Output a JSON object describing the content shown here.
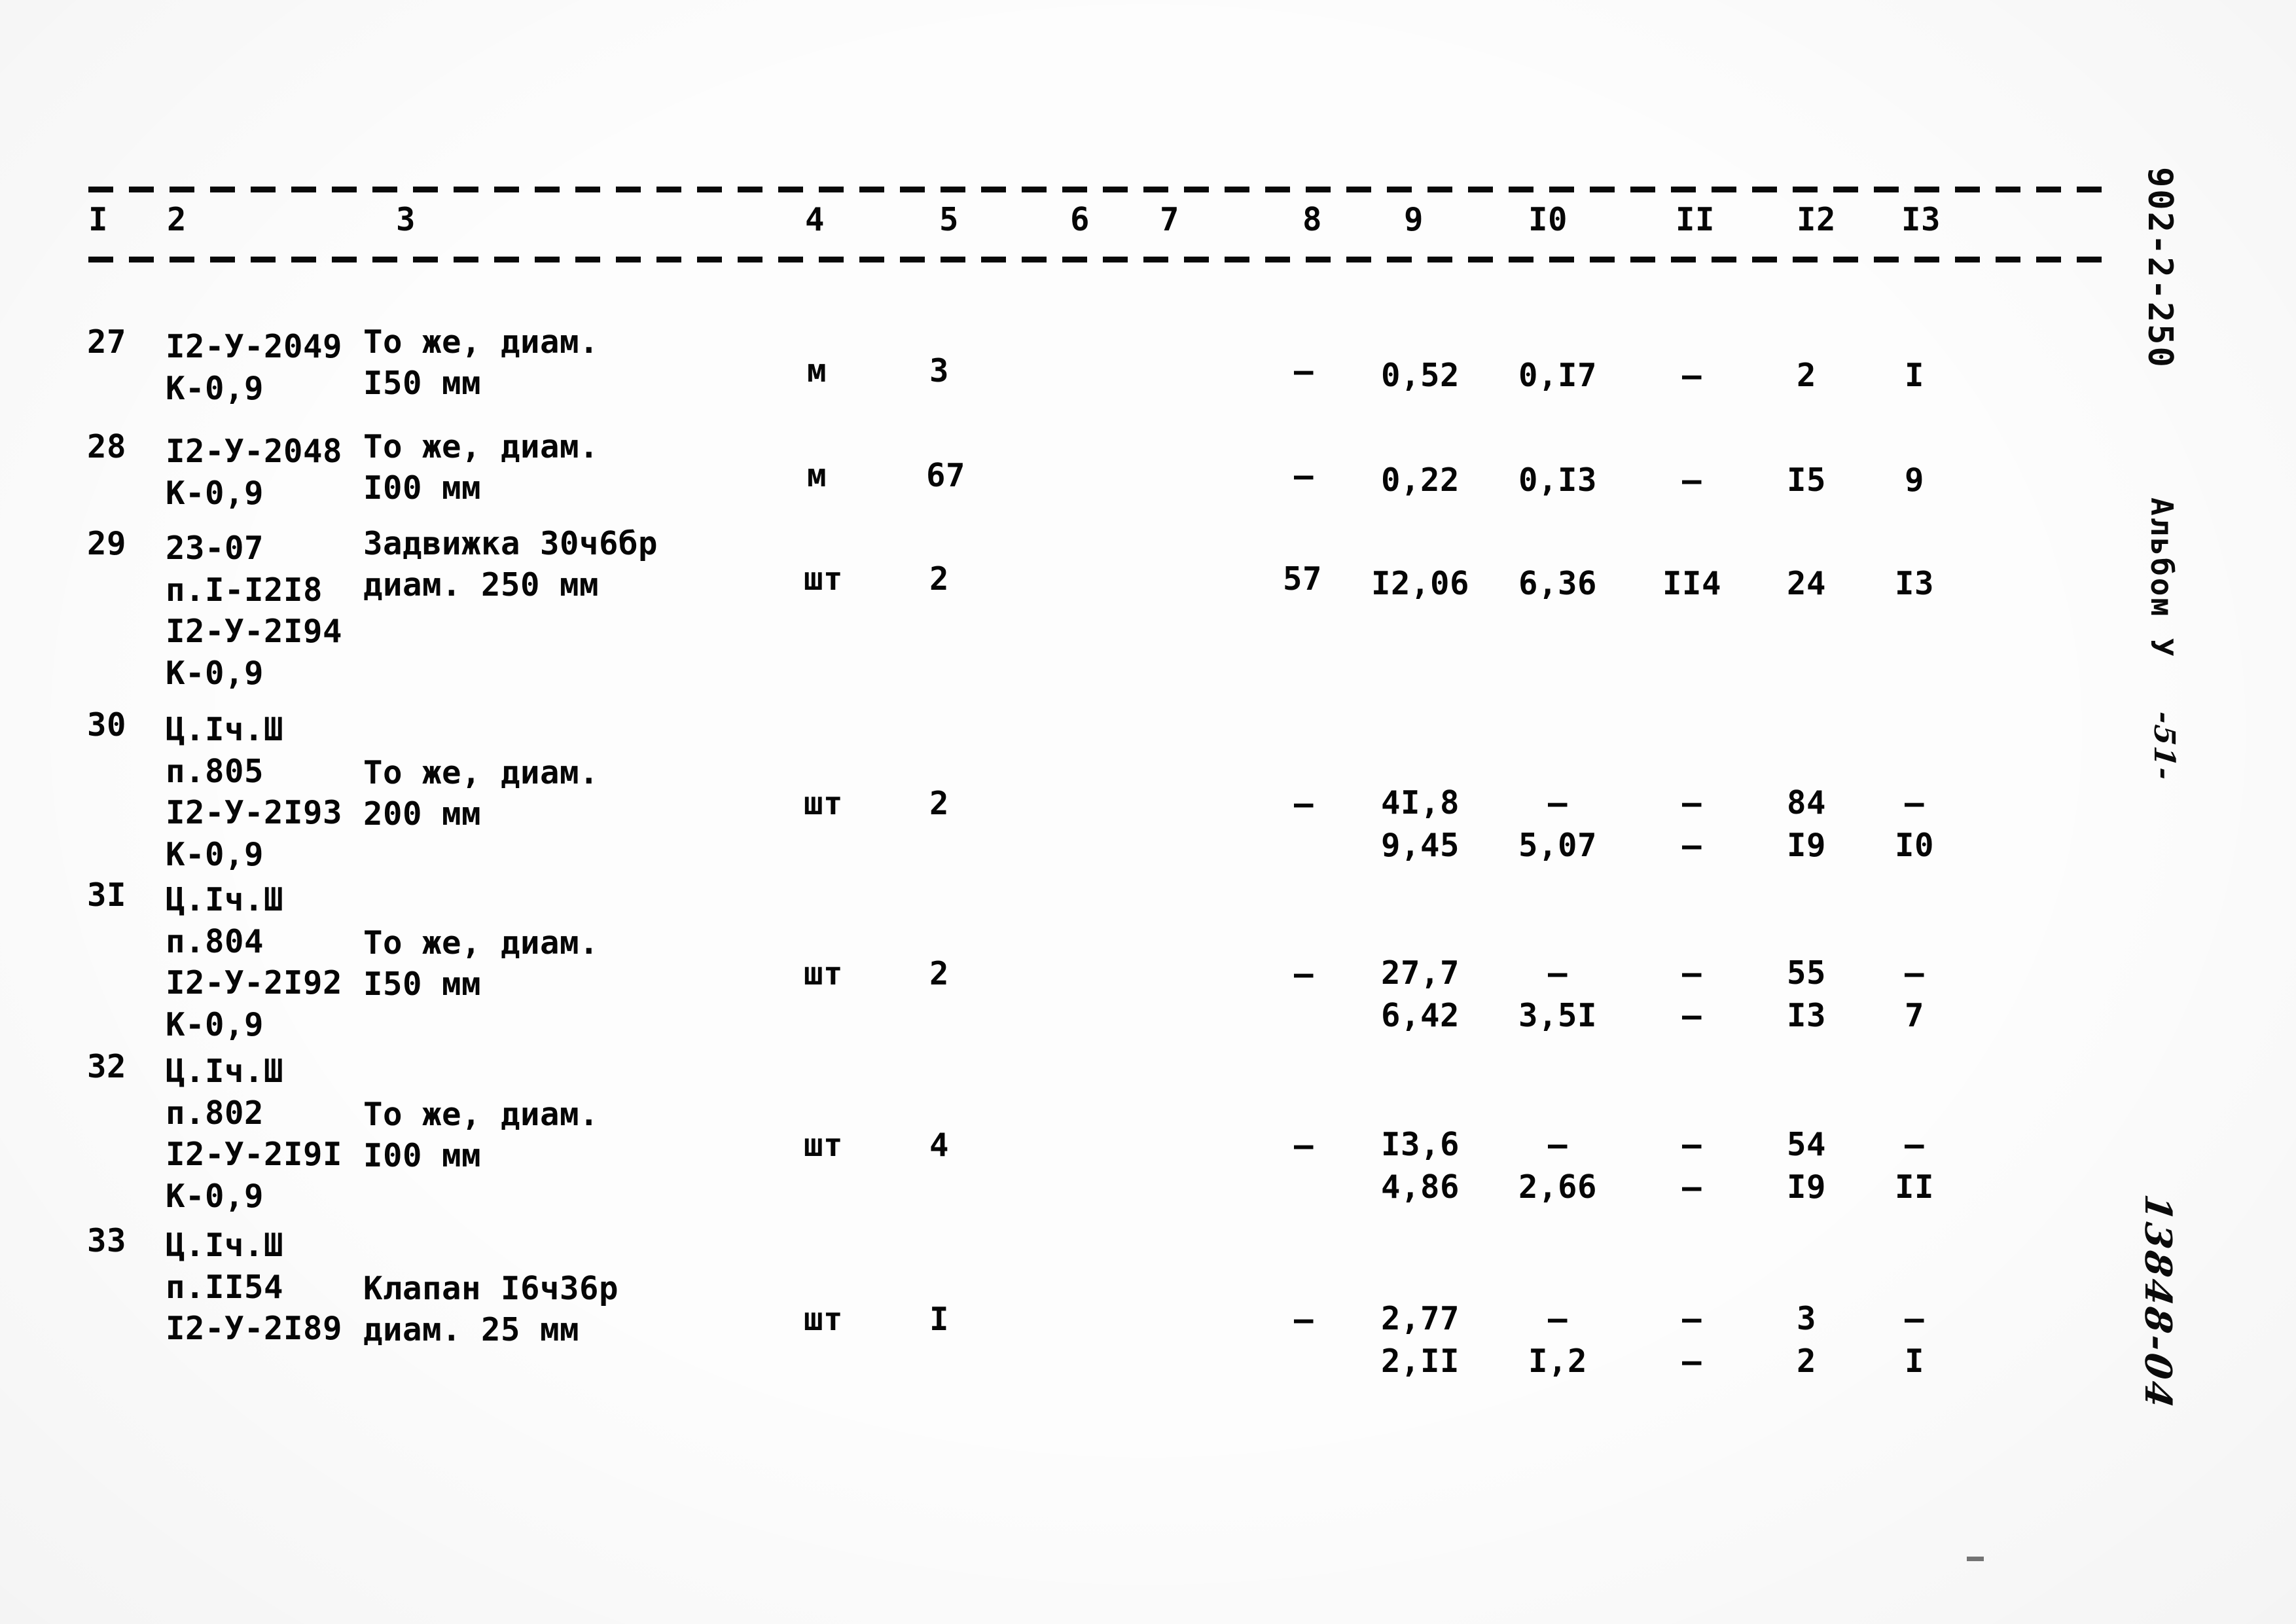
{
  "document": {
    "doc_code": "902-2-250",
    "album_label": "Альбом У",
    "page_number": "-51-",
    "archive_number": "13848-04"
  },
  "table": {
    "column_headers": [
      "I",
      "2",
      "3",
      "4",
      "5",
      "6",
      "7",
      "8",
      "9",
      "I0",
      "II",
      "I2",
      "I3"
    ],
    "rows": [
      {
        "no": "27",
        "code": "I2-У-2049\nК-0,9",
        "description": "То же, диам.\nI50 мм",
        "unit": "м",
        "qty": "3",
        "c6": "",
        "c7": "",
        "c8": "–",
        "c9": "0,52",
        "c10": "0,I7",
        "c11": "–",
        "c12": "2",
        "c13": "I"
      },
      {
        "no": "28",
        "code": "I2-У-2048\nК-0,9",
        "description": "То же, диам.\nI00 мм",
        "unit": "м",
        "qty": "67",
        "c6": "",
        "c7": "",
        "c8": "–",
        "c9": "0,22",
        "c10": "0,I3",
        "c11": "–",
        "c12": "I5",
        "c13": "9"
      },
      {
        "no": "29",
        "code": "23-07\nп.I-I2I8\nI2-У-2I94\nК-0,9",
        "description": "Задвижка 30ч6бр\nдиам. 250 мм",
        "unit": "шт",
        "qty": "2",
        "c6": "",
        "c7": "",
        "c8": "57",
        "c9": "I2,06",
        "c10": "6,36",
        "c11": "II4",
        "c12": "24",
        "c13": "I3"
      },
      {
        "no": "30",
        "code": "Ц.Iч.Ш\nп.805\nI2-У-2I93\nК-0,9",
        "description": "То же, диам.\n  200 мм",
        "unit": "шт",
        "qty": "2",
        "c6": "",
        "c7": "",
        "c8": "–",
        "c9": "4I,8\n9,45",
        "c10": "–\n5,07",
        "c11": "–\n–",
        "c12": "84\nI9",
        "c13": "–\nI0"
      },
      {
        "no": "3I",
        "code": "Ц.Iч.Ш\nп.804\nI2-У-2I92\nК-0,9",
        "description": "То же, диам.\n I50 мм",
        "unit": "шт",
        "qty": "2",
        "c6": "",
        "c7": "",
        "c8": "–",
        "c9": "27,7\n6,42",
        "c10": "–\n3,5I",
        "c11": "–\n–",
        "c12": "55\nI3",
        "c13": "–\n7"
      },
      {
        "no": "32",
        "code": "Ц.Iч.Ш\nп.802\nI2-У-2I9I\nК-0,9",
        "description": "То же, диам.\nI00 мм",
        "unit": "шт",
        "qty": "4",
        "c6": "",
        "c7": "",
        "c8": "–",
        "c9": "I3,6\n4,86",
        "c10": "–\n2,66",
        "c11": "–\n–",
        "c12": "54\nI9",
        "c13": "–\nII"
      },
      {
        "no": "33",
        "code": "Ц.Iч.Ш\nп.II54\nI2-У-2I89",
        "description": "Клапан I6ч36р\nдиам. 25 мм",
        "unit": "шт",
        "qty": "I",
        "c6": "",
        "c7": "",
        "c8": "–",
        "c9": "2,77\n2,II",
        "c10": "–\nI,2",
        "c11": "–\n–",
        "c12": "3\n2",
        "c13": "–\nI"
      }
    ]
  }
}
